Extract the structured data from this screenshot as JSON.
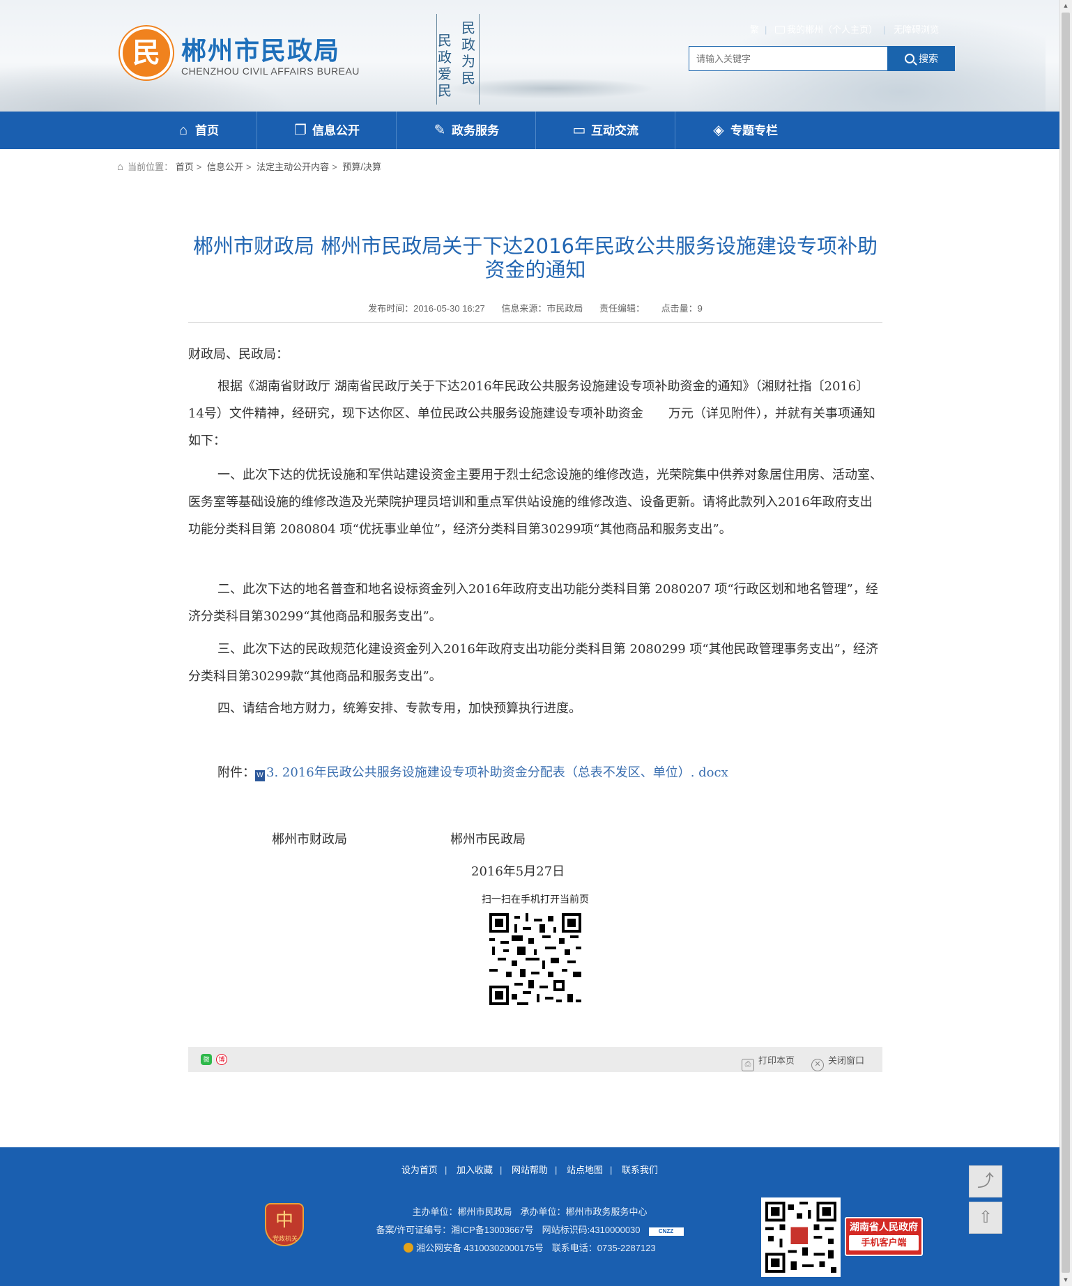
{
  "header": {
    "logo_mark": "民",
    "site_name_cn": "郴州市民政局",
    "site_name_en": "CHENZHOU CIVIL AFFAIRS BUREAU",
    "slogan_right": "民政为民",
    "slogan_left": "民政爱民",
    "top_links": [
      "繁",
      "我的郴州（个人主页）",
      "无障碍浏览"
    ],
    "search_placeholder": "请输入关键字",
    "search_button": "搜索"
  },
  "nav": {
    "items": [
      {
        "label": "首页",
        "icon": "⌂"
      },
      {
        "label": "信息公开",
        "icon": "❐"
      },
      {
        "label": "政务服务",
        "icon": "✎"
      },
      {
        "label": "互动交流",
        "icon": "▭"
      },
      {
        "label": "专题专栏",
        "icon": "◈"
      }
    ]
  },
  "breadcrumb": {
    "prefix": "当前位置：",
    "items": [
      "首页",
      "信息公开",
      "法定主动公开内容",
      "预算/决算"
    ],
    "separator": ">"
  },
  "article": {
    "title": "郴州市财政局 郴州市民政局关于下达2016年民政公共服务设施建设专项补助资金的通知",
    "meta": {
      "publish_time": "发布时间：2016-05-30 16:27",
      "source": "信息来源：市民政局",
      "editor": "责任编辑：",
      "views": "点击量：9"
    },
    "salutation": "财政局、民政局：",
    "paragraphs": [
      "根据《湖南省财政厅 湖南省民政厅关于下达2016年民政公共服务设施建设专项补助资金的通知》（湘财社指〔2016〕14号）文件精神，经研究，现下达你区、单位民政公共服务设施建设专项补助资金　　万元（详见附件），并就有关事项通知如下：",
      "一、此次下达的优抚设施和军供站建设资金主要用于烈士纪念设施的维修改造，光荣院集中供养对象居住用房、活动室、医务室等基础设施的维修改造及光荣院护理员培训和重点军供站设施的维修改造、设备更新。请将此款列入2016年政府支出功能分类科目第 2080804 项“优抚事业单位”，经济分类科目第30299项“其他商品和服务支出”。",
      "二、此次下达的地名普查和地名设标资金列入2016年政府支出功能分类科目第 2080207 项“行政区划和地名管理”，经济分类科目第30299“其他商品和服务支出”。",
      "三、此次下达的民政规范化建设资金列入2016年政府支出功能分类科目第 2080299 项“其他民政管理事务支出”，经济分类科目第30299款“其他商品和服务支出”。",
      "四、请结合地方财力，统筹安排、专款专用，加快预算执行进度。"
    ],
    "attachment_label": "附件：",
    "attachment_icon": "W",
    "attachment_link": "3. 2016年民政公共服务设施建设专项补助资金分配表（总表不发区、单位）. docx",
    "signer_1": "郴州市财政局",
    "signer_2": "郴州市民政局",
    "sign_date": "2016年5月27日",
    "qr_label": "扫一扫在手机打开当前页"
  },
  "sharebar": {
    "wechat_icon": "微",
    "weibo_icon": "博",
    "print_icon": "⎙",
    "print": "打印本页",
    "close_icon": "✕",
    "close": "关闭窗口"
  },
  "footer": {
    "links": [
      "设为首页",
      "加入收藏",
      "网站帮助",
      "站点地图",
      "联系我们"
    ],
    "host": "主办单位：郴州市民政局",
    "organizer": "承办单位：郴州市政务服务中心",
    "icp": "备案/许可证编号：湘ICP备13003667号",
    "site_id": "网站标识码:4310000030",
    "cnzz": "CNZZ",
    "police": "湘公网安备 43100302000175号",
    "phone": "联系电话：0735-2287123",
    "badge_mark": "中",
    "badge_text": "党政机关",
    "hn_title": "湖南省人民政府",
    "hn_sub": "手机客户端"
  },
  "side": {
    "share_icon": "⤴",
    "top_icon": "⇧"
  },
  "colors": {
    "nav_blue": "#1a5fb0",
    "title_blue": "#2266b2",
    "logo_orange": "#f0821e",
    "footer_blue": "#1a5fb0"
  }
}
